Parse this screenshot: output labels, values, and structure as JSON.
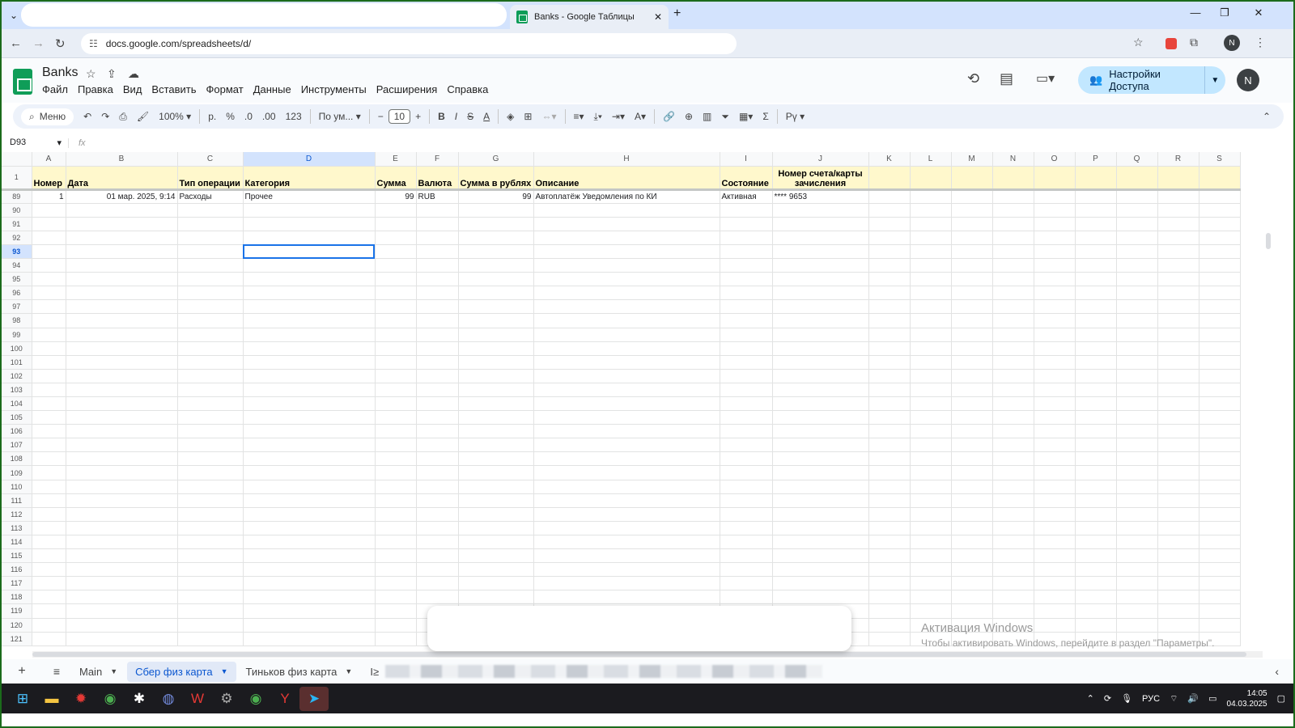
{
  "browser": {
    "tab_title": "Banks - Google Таблицы",
    "url": "docs.google.com/spreadsheets/d/",
    "new_tab": "+",
    "profile": "N"
  },
  "sheet": {
    "title": "Banks",
    "menu": [
      "Файл",
      "Правка",
      "Вид",
      "Вставить",
      "Формат",
      "Данные",
      "Инструменты",
      "Расширения",
      "Справка"
    ],
    "share_label": "Настройки Доступа",
    "account": "N"
  },
  "toolbar": {
    "search": "Меню",
    "zoom": "100%",
    "currency": "р.",
    "percent": "%",
    "dec_less": ".0",
    "dec_more": ".00",
    "num_format": "123",
    "font": "По ум...",
    "font_size": "10",
    "bold": "B",
    "italic": "I",
    "strike": "S",
    "text_color": "A",
    "sum": "Σ",
    "input_tools": "Рү"
  },
  "formula": {
    "cell": "D93",
    "fx": "fx"
  },
  "columns": [
    "A",
    "B",
    "C",
    "D",
    "E",
    "F",
    "G",
    "H",
    "I",
    "J",
    "K",
    "L",
    "M",
    "N",
    "O",
    "P",
    "Q",
    "R",
    "S"
  ],
  "header_row": {
    "num": "1",
    "cells": [
      "Номер",
      "Дата",
      "Тип операции",
      "Категория",
      "Сумма",
      "Валюта",
      "Сумма в рублях",
      "Описание",
      "Состояние",
      "Номер счета/карты зачисления",
      "",
      "",
      "",
      "",
      "",
      "",
      "",
      "",
      ""
    ]
  },
  "data_row": {
    "num": "89",
    "cells": [
      "1",
      "01 мар. 2025, 9:14",
      "Расходы",
      "Прочее",
      "99",
      "RUB",
      "99",
      "Автоплатёж Уведомления по КИ",
      "Активная",
      "**** 9653",
      "",
      "",
      "",
      "",
      "",
      "",
      "",
      "",
      ""
    ]
  },
  "empty_rows": [
    "90",
    "91",
    "92",
    "93",
    "94",
    "95",
    "96",
    "97",
    "98",
    "99",
    "100",
    "101",
    "102",
    "103",
    "104",
    "105",
    "106",
    "107",
    "108",
    "109",
    "110",
    "111",
    "112",
    "113",
    "114",
    "115",
    "116",
    "117",
    "118",
    "119",
    "120",
    "121"
  ],
  "selected_row": "93",
  "selected_col": "D",
  "sheet_tabs": [
    "Main",
    "Сбер физ карта",
    "Тиньков физ карта",
    "I≥"
  ],
  "active_tab": "Сбер физ карта",
  "watermark": {
    "line1": "Активация Windows",
    "line2": "Чтобы активировать Windows, перейдите в раздел \"Параметры\"."
  },
  "tray": {
    "lang": "РУС",
    "time": "14:05",
    "date": "04.03.2025"
  }
}
